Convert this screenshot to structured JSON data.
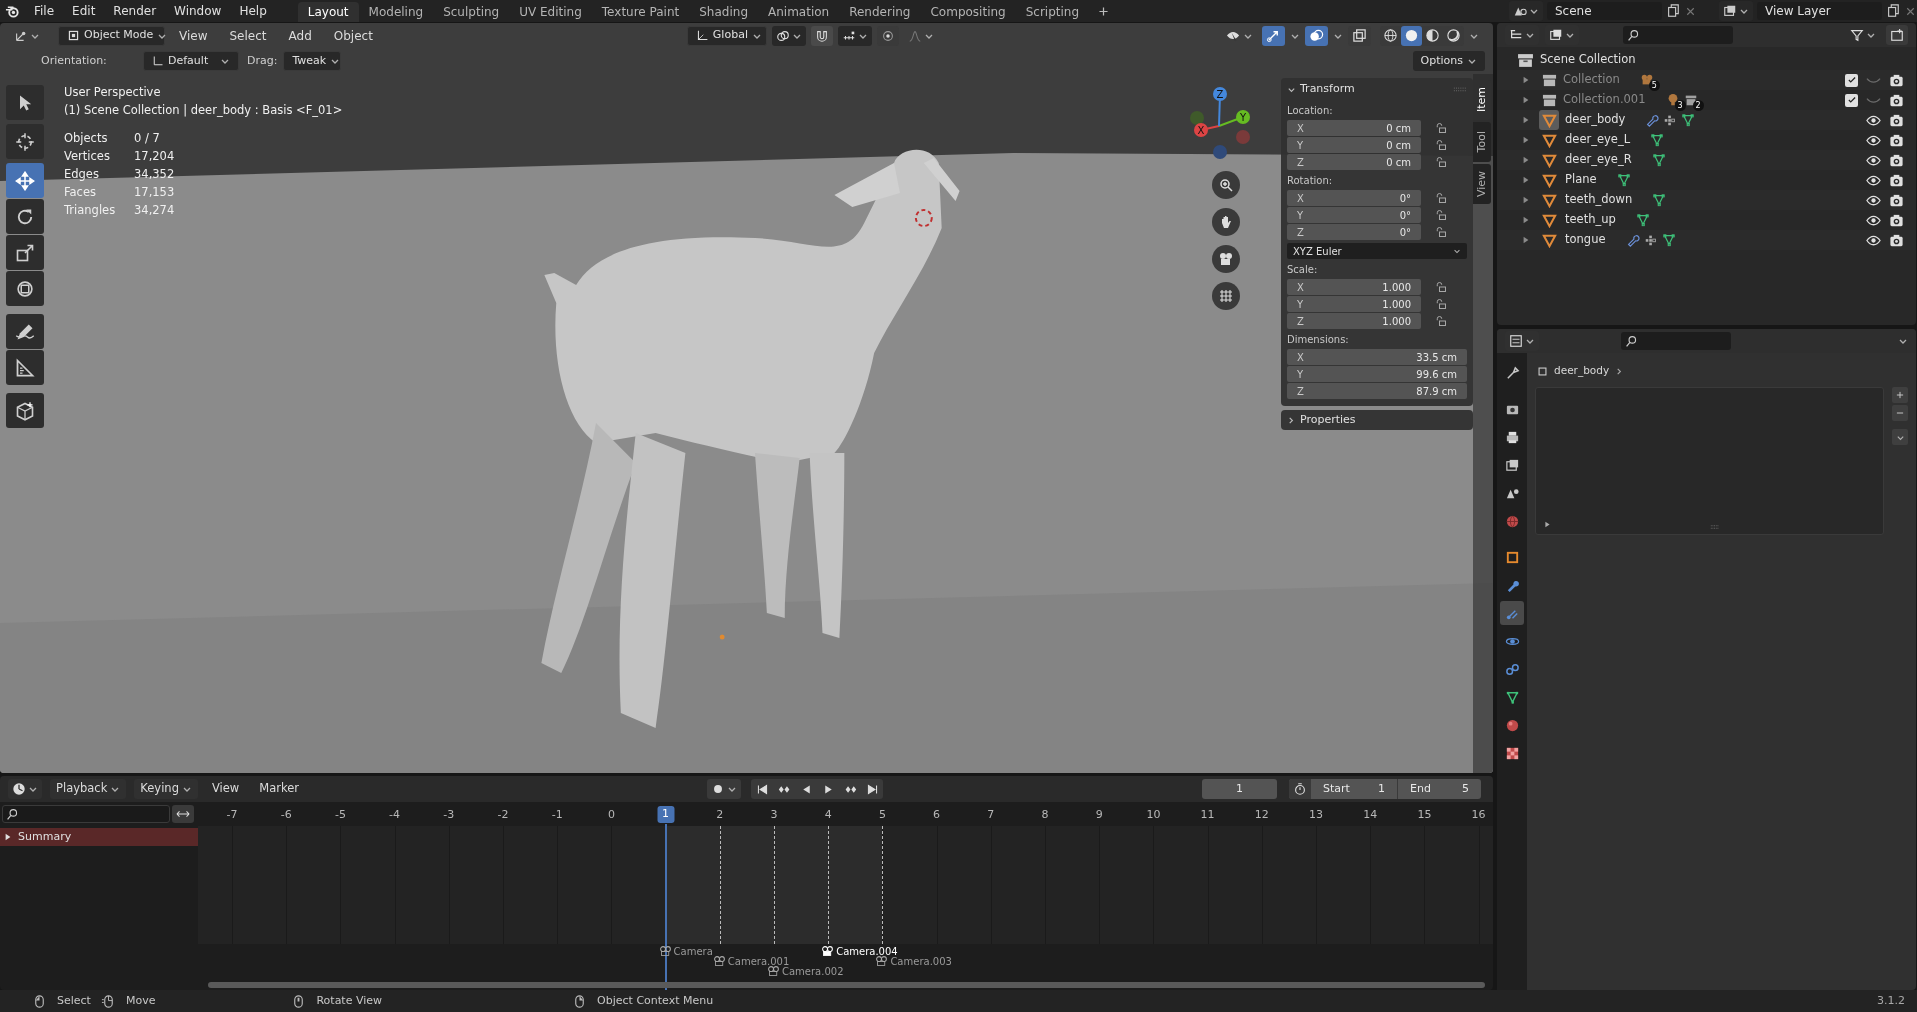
{
  "menu": [
    "File",
    "Edit",
    "Render",
    "Window",
    "Help"
  ],
  "workspaces": [
    {
      "label": "Layout",
      "selected": true
    },
    {
      "label": "Modeling",
      "selected": false
    },
    {
      "label": "Sculpting",
      "selected": false
    },
    {
      "label": "UV Editing",
      "selected": false
    },
    {
      "label": "Texture Paint",
      "selected": false
    },
    {
      "label": "Shading",
      "selected": false
    },
    {
      "label": "Animation",
      "selected": false
    },
    {
      "label": "Rendering",
      "selected": false
    },
    {
      "label": "Compositing",
      "selected": false
    },
    {
      "label": "Scripting",
      "selected": false
    }
  ],
  "scene": {
    "name": "Scene"
  },
  "view_layer": {
    "name": "View Layer"
  },
  "viewport": {
    "mode": "Object Mode",
    "menus": [
      "View",
      "Select",
      "Add",
      "Object"
    ],
    "orientation": "Global",
    "toggles": [
      {
        "kind": "gizmo",
        "on": true
      },
      {
        "kind": "overlay",
        "on": true
      },
      {
        "kind": "xray",
        "on": false
      }
    ],
    "shading": [
      {
        "kind": "wireframe",
        "selected": false
      },
      {
        "kind": "solid",
        "selected": true
      },
      {
        "kind": "material",
        "selected": false
      },
      {
        "kind": "rendered",
        "selected": false
      }
    ],
    "tool_settings": {
      "orientation_label": "Orientation:",
      "orientation": "Default",
      "drag_label": "Drag:",
      "drag": "Tweak",
      "options": "Options"
    },
    "tools": [
      {
        "kind": "select",
        "selected": false
      },
      {
        "kind": "cursor",
        "selected": false
      },
      {
        "kind": "move",
        "selected": true
      },
      {
        "kind": "rotate",
        "selected": false
      },
      {
        "kind": "scale",
        "selected": false
      },
      {
        "kind": "transform",
        "selected": false
      },
      {
        "kind": "annotate",
        "selected": false
      },
      {
        "kind": "measure",
        "selected": false
      },
      {
        "kind": "add_cube",
        "selected": false
      }
    ],
    "overlay_text": [
      "User Perspective",
      "(1) Scene Collection | deer_body : Basis <F_01>"
    ],
    "stats": [
      {
        "label": "Objects",
        "value": "0 / 7"
      },
      {
        "label": "Vertices",
        "value": "17,204"
      },
      {
        "label": "Edges",
        "value": "34,352"
      },
      {
        "label": "Faces",
        "value": "17,153"
      },
      {
        "label": "Triangles",
        "value": "34,274"
      }
    ],
    "gizmo_axes": [
      "X",
      "Y",
      "Z"
    ],
    "sidebar_tabs": [
      {
        "label": "Item",
        "selected": true
      },
      {
        "label": "Tool",
        "selected": false
      },
      {
        "label": "View",
        "selected": false
      }
    ],
    "transform": {
      "title": "Transform",
      "groups": [
        {
          "kind": "vector",
          "label": "Location:",
          "fields": [
            {
              "axis": "X",
              "value": "0 cm",
              "locked": false
            },
            {
              "axis": "Y",
              "value": "0 cm",
              "locked": false
            },
            {
              "axis": "Z",
              "value": "0 cm",
              "locked": false
            }
          ]
        },
        {
          "kind": "vector",
          "label": "Rotation:",
          "fields": [
            {
              "axis": "X",
              "value": "0°",
              "locked": false
            },
            {
              "axis": "Y",
              "value": "0°",
              "locked": false
            },
            {
              "axis": "Z",
              "value": "0°",
              "locked": false
            }
          ]
        },
        {
          "kind": "dropdown",
          "value": "XYZ Euler"
        },
        {
          "kind": "vector",
          "label": "Scale:",
          "fields": [
            {
              "axis": "X",
              "value": "1.000",
              "locked": false
            },
            {
              "axis": "Y",
              "value": "1.000",
              "locked": false
            },
            {
              "axis": "Z",
              "value": "1.000",
              "locked": false
            }
          ]
        },
        {
          "kind": "vector",
          "label": "Dimensions:",
          "fields": [
            {
              "axis": "X",
              "value": "33.5 cm"
            },
            {
              "axis": "Y",
              "value": "99.6 cm"
            },
            {
              "axis": "Z",
              "value": "87.9 cm"
            }
          ]
        }
      ]
    },
    "properties_panel": "Properties"
  },
  "outliner": {
    "root": "Scene Collection",
    "items": [
      {
        "kind": "collection",
        "name": "Collection",
        "visible": false,
        "checked": true,
        "badges": [
          {
            "kind": "camera",
            "count": "5"
          }
        ]
      },
      {
        "kind": "collection",
        "name": "Collection.001",
        "visible": false,
        "checked": true,
        "badges": [
          {
            "kind": "light",
            "count": "3"
          },
          {
            "kind": "collection",
            "count": "2"
          }
        ]
      },
      {
        "kind": "object",
        "name": "deer_body",
        "visible": true,
        "selected": true,
        "badges": [
          {
            "kind": "modifier"
          },
          {
            "kind": "grid"
          },
          {
            "kind": "mesh"
          }
        ]
      },
      {
        "kind": "object",
        "name": "deer_eye_L",
        "visible": true,
        "selected": false,
        "badges": [
          {
            "kind": "mesh"
          }
        ]
      },
      {
        "kind": "object",
        "name": "deer_eye_R",
        "visible": true,
        "selected": false,
        "badges": [
          {
            "kind": "mesh"
          }
        ]
      },
      {
        "kind": "object",
        "name": "Plane",
        "visible": true,
        "selected": false,
        "badges": [
          {
            "kind": "mesh"
          }
        ]
      },
      {
        "kind": "object",
        "name": "teeth_down",
        "visible": true,
        "selected": false,
        "badges": [
          {
            "kind": "mesh"
          }
        ]
      },
      {
        "kind": "object",
        "name": "teeth_up",
        "visible": true,
        "selected": false,
        "badges": [
          {
            "kind": "mesh"
          }
        ]
      },
      {
        "kind": "object",
        "name": "tongue",
        "visible": true,
        "selected": false,
        "badges": [
          {
            "kind": "modifier"
          },
          {
            "kind": "grid"
          },
          {
            "kind": "mesh"
          }
        ]
      }
    ]
  },
  "properties": {
    "breadcrumb": "deer_body",
    "tabs": [
      {
        "kind": "tool",
        "selected": false
      },
      {
        "kind": "render",
        "selected": false
      },
      {
        "kind": "output",
        "selected": false
      },
      {
        "kind": "view_layer",
        "selected": false
      },
      {
        "kind": "scene",
        "selected": false
      },
      {
        "kind": "world",
        "selected": false
      },
      {
        "kind": "object",
        "selected": false
      },
      {
        "kind": "modifiers",
        "selected": false
      },
      {
        "kind": "particles",
        "selected": true
      },
      {
        "kind": "physics",
        "selected": false
      },
      {
        "kind": "constraints",
        "selected": false
      },
      {
        "kind": "data",
        "selected": false
      },
      {
        "kind": "material",
        "selected": false
      },
      {
        "kind": "texture",
        "selected": false
      }
    ]
  },
  "timeline": {
    "menus": [
      {
        "label": "Playback",
        "dropdown": true
      },
      {
        "label": "Keying",
        "dropdown": true
      },
      {
        "label": "View",
        "dropdown": false
      },
      {
        "label": "Marker",
        "dropdown": false
      }
    ],
    "current_frame": "1",
    "start_label": "Start",
    "start": "1",
    "end_label": "End",
    "end": "5",
    "channel": "Summary",
    "frames": [
      {
        "label": "-7",
        "selected": false
      },
      {
        "label": "-6",
        "selected": false
      },
      {
        "label": "-5",
        "selected": false
      },
      {
        "label": "-4",
        "selected": false
      },
      {
        "label": "-3",
        "selected": false
      },
      {
        "label": "-2",
        "selected": false
      },
      {
        "label": "-1",
        "selected": false
      },
      {
        "label": "0",
        "selected": false
      },
      {
        "label": "1",
        "selected": true
      },
      {
        "label": "2",
        "selected": false
      },
      {
        "label": "3",
        "selected": false
      },
      {
        "label": "4",
        "selected": false
      },
      {
        "label": "5",
        "selected": false
      },
      {
        "label": "6",
        "selected": false
      },
      {
        "label": "7",
        "selected": false
      },
      {
        "label": "8",
        "selected": false
      },
      {
        "label": "9",
        "selected": false
      },
      {
        "label": "10",
        "selected": false
      },
      {
        "label": "11",
        "selected": false
      },
      {
        "label": "12",
        "selected": false
      },
      {
        "label": "13",
        "selected": false
      },
      {
        "label": "14",
        "selected": false
      },
      {
        "label": "15",
        "selected": false
      },
      {
        "label": "16",
        "selected": false
      }
    ],
    "markers": [
      {
        "name": "Camera",
        "selected": false
      },
      {
        "name": "Camera.001",
        "selected": false
      },
      {
        "name": "Camera.002",
        "selected": false
      },
      {
        "name": "Camera.004",
        "selected": true
      },
      {
        "name": "Camera.003",
        "selected": false
      }
    ]
  },
  "status_bar": {
    "hints": [
      {
        "kind": "mouse_left",
        "label": "Select"
      },
      {
        "kind": "mouse_drag",
        "label": "Move"
      },
      {
        "kind": "mouse_middle",
        "label": "Rotate View"
      },
      {
        "kind": "mouse_right",
        "label": "Object Context Menu"
      }
    ],
    "version": "3.1.2"
  }
}
